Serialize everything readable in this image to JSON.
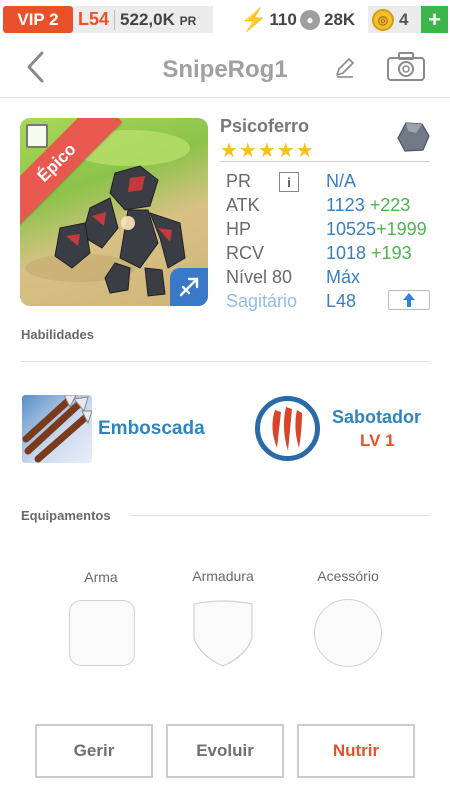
{
  "status_bar": {
    "vip": "VIP 2",
    "level": "L54",
    "gold_value": "522,0K",
    "gold_unit": "PR",
    "energy": "110",
    "paw": "28K",
    "gems": "4",
    "add": "+"
  },
  "header": {
    "title": "SnipeRog1"
  },
  "hero": {
    "rarity": "Épico",
    "name": "Psicoferro",
    "stars": "★★★★★",
    "star_count": 5,
    "stats": [
      {
        "label": "PR",
        "value": "N/A",
        "bonus": ""
      },
      {
        "label": "ATK",
        "value": "1123",
        "bonus": "+223"
      },
      {
        "label": "HP",
        "value": "10525",
        "bonus": "+1999"
      },
      {
        "label": "RCV",
        "value": "1018",
        "bonus": "+193"
      },
      {
        "label": "Nível 80",
        "value": "Máx",
        "bonus": ""
      },
      {
        "label": "Sagitário",
        "value": "L48",
        "bonus": ""
      }
    ],
    "info_glyph": "i"
  },
  "skills_section": {
    "label": "Habilidades",
    "skill1": "Emboscada",
    "skill2": "Sabotador",
    "skill2_level": "LV 1"
  },
  "equipment_section": {
    "label": "Equipamentos",
    "slots": [
      "Arma",
      "Armadura",
      "Acessório"
    ]
  },
  "actions": {
    "manage": "Gerir",
    "evolve": "Evoluir",
    "feed": "Nutrir"
  },
  "colors": {
    "accent_orange": "#e8512a",
    "link_blue": "#3a7ec2",
    "bonus_green": "#4cb64e",
    "star_gold": "#f4c21a"
  }
}
